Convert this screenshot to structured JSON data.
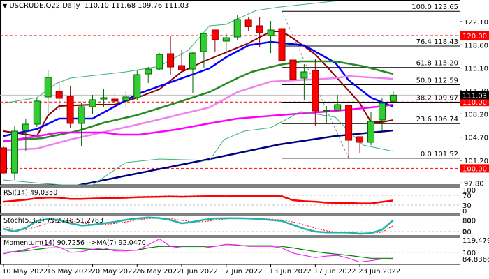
{
  "header": {
    "arrow": "▼",
    "symbol": "USCRUDE.Q22,Daily",
    "ohlc": "110.10 111.68 109.76 111.03"
  },
  "indicators": {
    "rsi_label": "RSI(14) 49.0350",
    "stoch_label": "Stoch(5,3,3) 79.2718 51.2783",
    "momentum_label": "Momentum(14) 90.7256  ->MA(7) 92.0470"
  },
  "colors": {
    "bull": "#32cd32",
    "bull_edge": "#006400",
    "bear": "#ff0000",
    "bear_edge": "#8b0000",
    "ema_fast": "#8b0000",
    "ema_mid": "#0000ff",
    "ema_slow": "#228b22",
    "ma_violet": "#ee82ee",
    "ma_magenta": "#ff00ff",
    "ma_navy": "#000080",
    "bands": "#3cb371",
    "tag_red": "#ff0000",
    "tag_black": "#000000"
  },
  "chart_data": {
    "type": "candlestick",
    "title": "USCRUDE.Q22,Daily",
    "x_tick_labels": [
      {
        "index": 0,
        "label": "10 May 2022"
      },
      {
        "index": 4,
        "label": "16 May 2022"
      },
      {
        "index": 8,
        "label": "20 May 2022"
      },
      {
        "index": 12,
        "label": "26 May 2022"
      },
      {
        "index": 16,
        "label": "1 Jun 2022"
      },
      {
        "index": 20,
        "label": "7 Jun 2022"
      },
      {
        "index": 24,
        "label": "13 Jun 2022"
      },
      {
        "index": 28,
        "label": "17 Jun 2022"
      },
      {
        "index": 32,
        "label": "23 Jun 2022"
      }
    ],
    "price_axis": {
      "range": [
        97.5,
        124.8
      ],
      "ticks": [
        "122.10",
        "118.60",
        "115.10",
        "111.70",
        "108.20",
        "104.70",
        "101.20",
        "97.80"
      ]
    },
    "candles_ohlc": [
      [
        103.09,
        103.3,
        99.1,
        99.31
      ],
      [
        99.31,
        106.45,
        98.26,
        105.61
      ],
      [
        105.71,
        107.39,
        102.56,
        106.66
      ],
      [
        106.66,
        110.65,
        106.24,
        110.13
      ],
      [
        110.76,
        114.85,
        108.02,
        113.7
      ],
      [
        111.6,
        113.17,
        108.86,
        110.55
      ],
      [
        110.86,
        112.44,
        106.13,
        106.77
      ],
      [
        106.77,
        109.81,
        103.3,
        109.28
      ],
      [
        109.28,
        111.07,
        108.13,
        110.34
      ],
      [
        110.44,
        111.91,
        109.18,
        110.65
      ],
      [
        110.44,
        111.39,
        108.55,
        110.13
      ],
      [
        110.23,
        111.7,
        109.28,
        110.76
      ],
      [
        110.65,
        114.85,
        110.34,
        114.12
      ],
      [
        114.22,
        115.27,
        112.86,
        114.96
      ],
      [
        114.96,
        117.37,
        114.85,
        117.16
      ],
      [
        117.27,
        120.0,
        114.01,
        115.27
      ],
      [
        115.48,
        117.79,
        114.54,
        114.85
      ],
      [
        114.96,
        117.58,
        111.28,
        117.37
      ],
      [
        117.58,
        120.42,
        115.17,
        120.31
      ],
      [
        120.84,
        120.84,
        117.48,
        119.37
      ],
      [
        119.16,
        120.31,
        117.16,
        119.68
      ],
      [
        119.79,
        123.15,
        119.26,
        122.42
      ],
      [
        122.42,
        122.73,
        120.73,
        121.36
      ],
      [
        121.47,
        122.73,
        118.21,
        120.42
      ],
      [
        120.0,
        122.2,
        117.37,
        120.84
      ],
      [
        121.05,
        123.65,
        114.12,
        116.22
      ],
      [
        116.32,
        116.95,
        112.44,
        113.38
      ],
      [
        113.59,
        115.69,
        110.34,
        114.54
      ],
      [
        114.75,
        116.53,
        106.34,
        108.65
      ],
      [
        108.65,
        109.39,
        106.77,
        108.76
      ],
      [
        108.76,
        111.07,
        108.76,
        109.6
      ],
      [
        109.49,
        109.6,
        101.52,
        104.24
      ],
      [
        104.77,
        104.77,
        102.25,
        103.93
      ],
      [
        103.93,
        108.55,
        103.51,
        107.08
      ],
      [
        107.29,
        110.55,
        105.61,
        109.81
      ],
      [
        110.1,
        111.68,
        109.76,
        111.03
      ]
    ],
    "overlays": [
      {
        "name": "ema-fast",
        "color": "ema_fast",
        "width": 2,
        "points": [
          [
            0,
            105.61
          ],
          [
            3,
            104.88
          ],
          [
            4,
            107.99
          ],
          [
            5,
            109.39
          ],
          [
            8,
            109.6
          ],
          [
            10,
            109.6
          ],
          [
            12,
            110.65
          ],
          [
            14,
            111.91
          ],
          [
            16,
            114.54
          ],
          [
            18,
            116.11
          ],
          [
            20,
            117.48
          ],
          [
            22,
            118.84
          ],
          [
            24,
            120.63
          ],
          [
            25,
            120.63
          ],
          [
            26,
            119.58
          ],
          [
            28,
            117.16
          ],
          [
            29,
            115.38
          ],
          [
            31,
            111.7
          ],
          [
            32,
            109.81
          ],
          [
            33,
            106.97
          ],
          [
            34,
            106.97
          ],
          [
            35,
            107.29
          ]
        ]
      },
      {
        "name": "ema-mid",
        "color": "ema_mid",
        "width": 2.5,
        "points": [
          [
            0,
            104.87
          ],
          [
            3,
            105.92
          ],
          [
            5,
            107.5
          ],
          [
            8,
            107.5
          ],
          [
            12,
            111.18
          ],
          [
            18.5,
            115.06
          ],
          [
            20,
            116.74
          ],
          [
            22,
            118.53
          ],
          [
            24,
            119.05
          ],
          [
            27,
            118.53
          ],
          [
            29.8,
            115.9
          ],
          [
            31,
            113.28
          ],
          [
            33,
            110.65
          ],
          [
            35,
            109.28
          ]
        ]
      },
      {
        "name": "ema-slow",
        "color": "ema_slow",
        "width": 2.5,
        "points": [
          [
            0,
            104.14
          ],
          [
            3.5,
            104.56
          ],
          [
            6.6,
            105.61
          ],
          [
            9,
            106.87
          ],
          [
            12,
            108.02
          ],
          [
            15.4,
            109.81
          ],
          [
            18.5,
            111.49
          ],
          [
            21,
            113.59
          ],
          [
            22.3,
            114.54
          ],
          [
            24.8,
            115.59
          ],
          [
            26.7,
            116.11
          ],
          [
            29.8,
            116.11
          ],
          [
            32.3,
            115.38
          ],
          [
            35,
            114.22
          ]
        ]
      },
      {
        "name": "ma-violet",
        "color": "ma_violet",
        "width": 2.5,
        "points": [
          [
            0,
            102.77
          ],
          [
            3,
            102.98
          ],
          [
            6,
            104.35
          ],
          [
            12.2,
            106.66
          ],
          [
            18.5,
            109.18
          ],
          [
            21,
            111.49
          ],
          [
            24,
            113.07
          ],
          [
            29.8,
            113.59
          ],
          [
            31,
            113.9
          ],
          [
            35,
            113.49
          ]
        ]
      },
      {
        "name": "ma-magenta",
        "color": "ma_magenta",
        "width": 2.5,
        "points": [
          [
            0,
            104.03
          ],
          [
            5,
            105.4
          ],
          [
            9,
            105.4
          ],
          [
            10.4,
            105.08
          ],
          [
            12.2,
            105.08
          ],
          [
            15.4,
            105.82
          ],
          [
            18.5,
            106.77
          ],
          [
            21,
            107.5
          ],
          [
            24.8,
            108.02
          ],
          [
            29.8,
            108.65
          ],
          [
            33.6,
            109.28
          ],
          [
            35,
            109.6
          ]
        ]
      },
      {
        "name": "ma-navy",
        "color": "ma_navy",
        "width": 2.5,
        "points": [
          [
            0,
            95.2
          ],
          [
            6.9,
            97.52
          ],
          [
            18.5,
            101.41
          ],
          [
            24.8,
            103.61
          ],
          [
            29.8,
            104.87
          ],
          [
            35,
            105.71
          ]
        ]
      },
      {
        "name": "band-upper",
        "color": "bands",
        "width": 1,
        "points": [
          [
            0,
            109.81
          ],
          [
            3,
            110.65
          ],
          [
            4.7,
            112.75
          ],
          [
            6,
            113.59
          ],
          [
            11,
            114.54
          ],
          [
            14,
            115.38
          ],
          [
            16.6,
            117.79
          ],
          [
            18.5,
            121.47
          ],
          [
            20,
            121.68
          ],
          [
            20.6,
            122.2
          ],
          [
            22.7,
            123.78
          ],
          [
            24.8,
            124.3
          ],
          [
            30.7,
            125.36
          ],
          [
            35,
            126.5
          ]
        ]
      },
      {
        "name": "band-lower",
        "color": "bands",
        "width": 1,
        "points": [
          [
            0,
            98.26
          ],
          [
            3.5,
            97.73
          ],
          [
            5.3,
            97.52
          ],
          [
            8,
            97.52
          ],
          [
            11,
            100.88
          ],
          [
            14,
            101.41
          ],
          [
            18.5,
            101.2
          ],
          [
            19.8,
            104.35
          ],
          [
            21.6,
            105.61
          ],
          [
            24,
            106.13
          ],
          [
            26.7,
            108.55
          ],
          [
            29.8,
            107.71
          ],
          [
            31,
            105.61
          ],
          [
            32.3,
            103.51
          ],
          [
            35,
            102.56
          ]
        ]
      }
    ],
    "fibonacci": {
      "from_index": 25,
      "levels": [
        {
          "label": "100.0 123.65",
          "price": 123.65
        },
        {
          "label": "76.4 118.43",
          "price": 118.43
        },
        {
          "label": "61.8 115.20",
          "price": 115.2
        },
        {
          "label": "50.0 112.59",
          "price": 112.59
        },
        {
          "label": "38.2 109.97",
          "price": 109.97
        },
        {
          "label": "23.6 106.74",
          "price": 106.74
        },
        {
          "label": "0.0 101.52",
          "price": 101.52
        }
      ],
      "trendline": [
        [
          25,
          123.65
        ],
        [
          31,
          101.52
        ]
      ]
    },
    "horizontal_levels": [
      {
        "price": 120.0,
        "tag": "120.00",
        "style": "red-dashed"
      },
      {
        "price": 110.0,
        "tag": "110.00",
        "style": "red-dashed"
      },
      {
        "price": 100.0,
        "tag": "100.00",
        "style": "red-dashed"
      },
      {
        "price": 111.03,
        "tag": "111.03",
        "style": "bid"
      }
    ],
    "rsi": {
      "levels": [
        70,
        30
      ],
      "axis_labels": [
        "100",
        "70",
        "30",
        "0"
      ],
      "values": [
        44,
        48,
        52,
        58,
        61,
        60,
        55,
        55,
        57,
        58,
        59,
        60,
        62,
        63,
        64,
        65,
        64,
        65,
        66,
        67,
        66,
        67,
        68,
        68,
        67,
        66,
        50,
        46,
        44,
        40,
        39,
        39,
        37,
        37,
        43,
        49
      ]
    },
    "stochastic": {
      "levels": [
        80,
        20
      ],
      "axis_labels": [
        "100",
        "80",
        "20",
        "0"
      ],
      "k": [
        34,
        21,
        39,
        75,
        85,
        80,
        63,
        51,
        55,
        63,
        70,
        81,
        88,
        93,
        90,
        80,
        63,
        70,
        81,
        88,
        89,
        89,
        88,
        85,
        80,
        75,
        55,
        35,
        20,
        16,
        16,
        15,
        9,
        12,
        30,
        79
      ],
      "d": [
        45,
        32,
        30,
        45,
        65,
        80,
        75,
        65,
        57,
        57,
        62,
        70,
        80,
        87,
        90,
        87,
        78,
        71,
        71,
        80,
        86,
        89,
        89,
        87,
        85,
        80,
        70,
        55,
        37,
        24,
        17,
        16,
        13,
        12,
        17,
        51
      ]
    },
    "momentum": {
      "level": 100,
      "axis_labels": [
        "119.4793",
        "100",
        "84.8366"
      ],
      "range": [
        84.8366,
        119.4793
      ],
      "values": [
        98,
        101,
        104,
        108,
        110,
        107,
        100,
        101,
        104,
        106,
        102,
        102,
        103,
        110,
        118,
        108,
        106,
        106,
        106,
        108,
        111,
        110,
        108,
        108,
        108,
        106,
        99,
        96,
        93,
        95,
        96,
        92,
        87,
        89,
        91,
        90.7
      ],
      "ma": [
        100,
        101,
        102,
        104,
        106,
        106,
        105.5,
        105,
        104,
        104,
        103.5,
        103,
        103,
        106,
        108,
        108,
        108,
        108,
        108,
        108.5,
        109,
        109,
        109,
        109,
        109,
        108,
        106,
        103.5,
        101,
        99,
        97.5,
        96,
        94,
        92,
        92,
        92
      ]
    }
  }
}
